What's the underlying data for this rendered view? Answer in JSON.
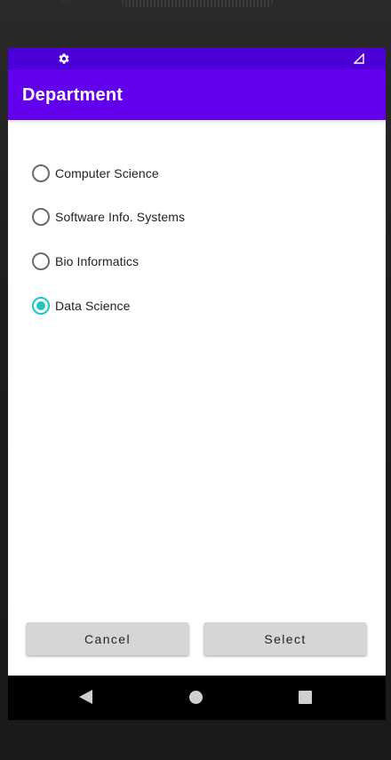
{
  "app_bar": {
    "title": "Department"
  },
  "colors": {
    "status_bar": "#4a00d6",
    "app_bar": "#6200ee",
    "accent": "#1cc7c1",
    "button": "#d6d6d6"
  },
  "status_bar": {
    "icons": [
      "gear-icon",
      "signal-icon"
    ]
  },
  "options": [
    {
      "label": "Computer Science",
      "checked": false
    },
    {
      "label": "Software Info. Systems",
      "checked": false
    },
    {
      "label": "Bio Informatics",
      "checked": false
    },
    {
      "label": "Data Science",
      "checked": true
    }
  ],
  "buttons": {
    "cancel_label": "Cancel",
    "select_label": "Select"
  },
  "nav_bar": {
    "icons": [
      "back-icon",
      "home-icon",
      "recents-icon"
    ]
  }
}
